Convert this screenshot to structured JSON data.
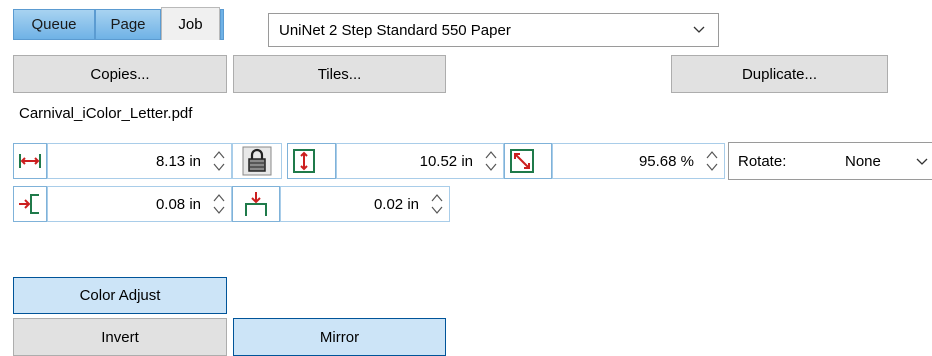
{
  "tabs": [
    {
      "label": "Queue",
      "active": false
    },
    {
      "label": "Page",
      "active": false
    },
    {
      "label": "Job",
      "active": true
    }
  ],
  "paper_dropdown": {
    "value": "UniNet 2 Step Standard 550 Paper"
  },
  "buttons": {
    "copies": "Copies...",
    "tiles": "Tiles...",
    "duplicate": "Duplicate...",
    "color_adjust": "Color Adjust",
    "invert": "Invert",
    "mirror": "Mirror"
  },
  "filename": "Carnival_iColor_Letter.pdf",
  "size": {
    "width": "8.13 in",
    "height": "10.52 in",
    "scale": "95.68 %"
  },
  "rotate": {
    "label": "Rotate:",
    "value": "None"
  },
  "offsets": {
    "left": "0.08 in",
    "top": "0.02 in"
  },
  "icons": {
    "width": "width-arrows-icon",
    "lock": "padlock-icon",
    "height": "height-arrows-icon",
    "scale": "scale-diagonal-icon",
    "left_margin": "left-margin-icon",
    "top_margin": "top-margin-icon",
    "spinner": "up-down-spinner-icon",
    "chevron": "chevron-down-icon"
  },
  "colors": {
    "tab_blue": "#6fb2e6",
    "selected_button": "#cce4f7",
    "icon_red": "#cc1f1f",
    "icon_green": "#1f7a4a"
  }
}
